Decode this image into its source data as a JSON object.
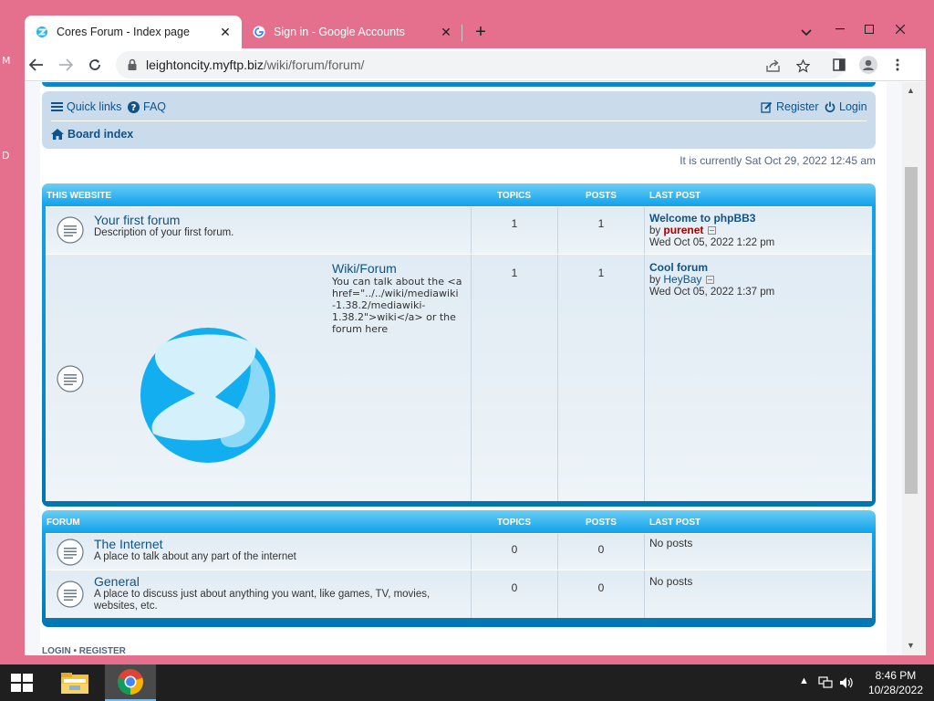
{
  "desktop": {
    "edge_top": "M",
    "edge_mid": "D"
  },
  "browser": {
    "tabs": [
      {
        "title": "Cores Forum - Index page",
        "close": "✕",
        "active": true
      },
      {
        "title": "Sign in - Google Accounts",
        "close": "✕",
        "active": false
      }
    ],
    "new_tab": "+",
    "url_host": "leightoncity.myftp.biz",
    "url_path": "/wiki/forum/forum/"
  },
  "forum": {
    "nav": {
      "quick_links": "Quick links",
      "faq": "FAQ",
      "register": "Register",
      "login": "Login",
      "board_index": "Board index"
    },
    "current_time": "It is currently Sat Oct 29, 2022 12:45 am",
    "sections": [
      {
        "header": {
          "name": "THIS WEBSITE",
          "topics": "TOPICS",
          "posts": "POSTS",
          "last_post": "LAST POST"
        },
        "rows": [
          {
            "title": "Your first forum",
            "description": "Description of your first forum.",
            "topics": "1",
            "posts": "1",
            "last_post_title": "Welcome to phpBB3",
            "last_post_by": "by",
            "last_post_user": "purenet",
            "last_post_date": "Wed Oct 05, 2022 1:22 pm"
          },
          {
            "title": "Wiki/Forum",
            "description_lines": [
              "You can talk about the <a",
              "href=\"../../wiki/mediawiki",
              "-1.38.2/mediawiki-",
              "1.38.2\">wiki</a> or the",
              "forum here"
            ],
            "topics": "1",
            "posts": "1",
            "last_post_title": "Cool forum",
            "last_post_by": "by",
            "last_post_user": "HeyBay",
            "last_post_date": "Wed Oct 05, 2022 1:37 pm"
          }
        ]
      },
      {
        "header": {
          "name": "FORUM",
          "topics": "TOPICS",
          "posts": "POSTS",
          "last_post": "LAST POST"
        },
        "rows": [
          {
            "title": "The Internet",
            "description": "A place to talk about any part of the internet",
            "topics": "0",
            "posts": "0",
            "last_post": "No posts"
          },
          {
            "title": "General",
            "description_lines": [
              "A place to discuss just about anything you want, like games, TV, movies,",
              "websites, etc."
            ],
            "topics": "0",
            "posts": "0",
            "last_post": "No posts"
          }
        ]
      }
    ],
    "footer_links": "LOGIN • REGISTER"
  },
  "taskbar": {
    "time": "8:46 PM",
    "date": "10/28/2022"
  },
  "colors": {
    "desktop": "#e4708e",
    "link": "#105289",
    "header_blue": "#12a3eb",
    "row_bg": "#e0ebf3"
  }
}
